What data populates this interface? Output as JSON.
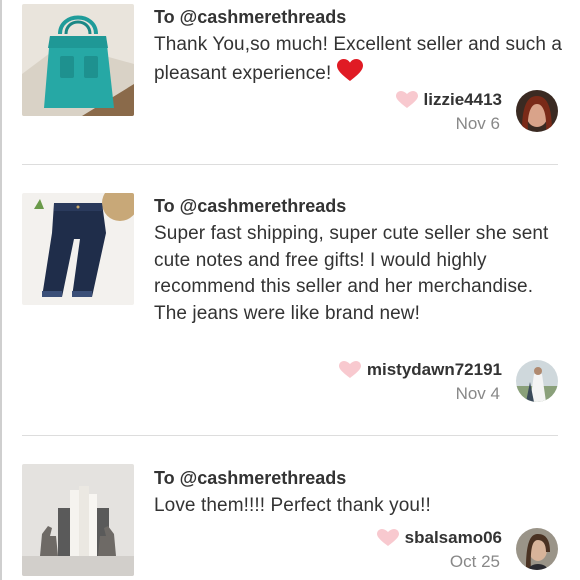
{
  "reviews": [
    {
      "to": "To @cashmerethreads",
      "message": "Thank You,so much! Excellent seller and such a pleasant experience!",
      "emoji_icon": "red-heart-emoji",
      "username": "lizzie4413",
      "date": "Nov 6",
      "thumb_icon": "teal-tote-bag"
    },
    {
      "to": "To @cashmerethreads",
      "message": "Super fast shipping, super cute seller she sent cute notes and free gifts! I would highly recommend this seller and her merchandise. The jeans were like brand new!",
      "username": "mistydawn72191",
      "date": "Nov 4",
      "thumb_icon": "denim-capri-jeans"
    },
    {
      "to": "To @cashmerethreads",
      "message": "Love them!!!! Perfect thank you!!",
      "username": "sbalsamo06",
      "date": "Oct 25",
      "thumb_icon": "horse-bookends"
    }
  ],
  "colors": {
    "text": "#333333",
    "date": "#888888",
    "like_heart": "#f8c9cf",
    "divider": "#dddddd"
  }
}
